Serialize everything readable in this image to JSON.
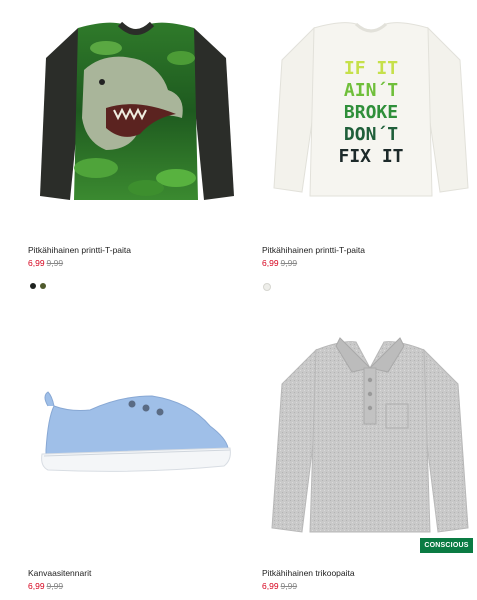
{
  "products": [
    {
      "title": "Pitkähihainen printti-T-paita",
      "sale_price": "6,99",
      "original_price": "9,99",
      "swatches": [
        "#1f2320",
        "#4f5a2c"
      ],
      "image_icon": "dinosaur-print-tshirt-image"
    },
    {
      "title": "Pitkähihainen printti-T-paita",
      "sale_price": "6,99",
      "original_price": "9,99",
      "swatches": [
        "#eeeeea"
      ],
      "image_icon": "slogan-print-tshirt-image",
      "print_lines": [
        "IF IT",
        "AIN´T",
        "BROKE",
        "DON´T",
        "FIX IT"
      ]
    },
    {
      "title": "Kanvaasitennarit",
      "sale_price": "6,99",
      "original_price": "9,99",
      "image_icon": "canvas-sneaker-image"
    },
    {
      "title": "Pitkähihainen trikoopaita",
      "sale_price": "6,99",
      "original_price": "9,99",
      "badge": "CONSCIOUS",
      "image_icon": "polo-shirt-image"
    }
  ],
  "colors": {
    "sale": "#d6001c",
    "badge": "#0a7b43"
  }
}
